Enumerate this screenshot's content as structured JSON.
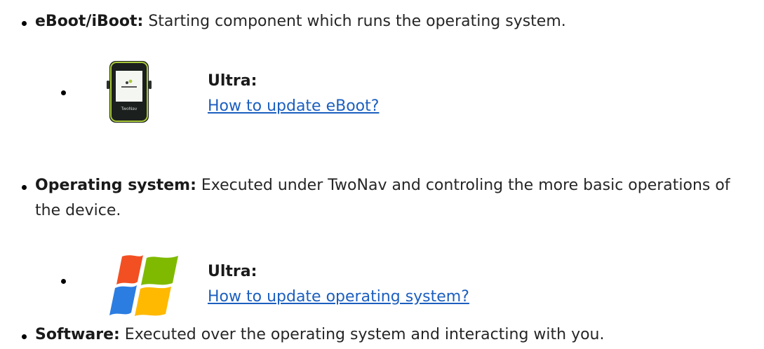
{
  "items": [
    {
      "term": "eBoot/iBoot:",
      "desc": "Starting component which runs the operating system.",
      "sub": {
        "image": "twonav-ultra-device",
        "title": "Ultra:",
        "link": "How to update eBoot?"
      }
    },
    {
      "term": "Operating system:",
      "desc": "Executed under TwoNav and controling the more basic operations of the device.",
      "sub": {
        "image": "windows-logo",
        "title": "Ultra:",
        "link": "How to update operating system?"
      }
    },
    {
      "term": "Software:",
      "desc": "Executed over the operating system and interacting with you."
    }
  ],
  "device_screen_text": "TwoNav",
  "colors": {
    "link": "#1c5fbf",
    "text": "#262626",
    "device_accent": "#a8c93a"
  }
}
